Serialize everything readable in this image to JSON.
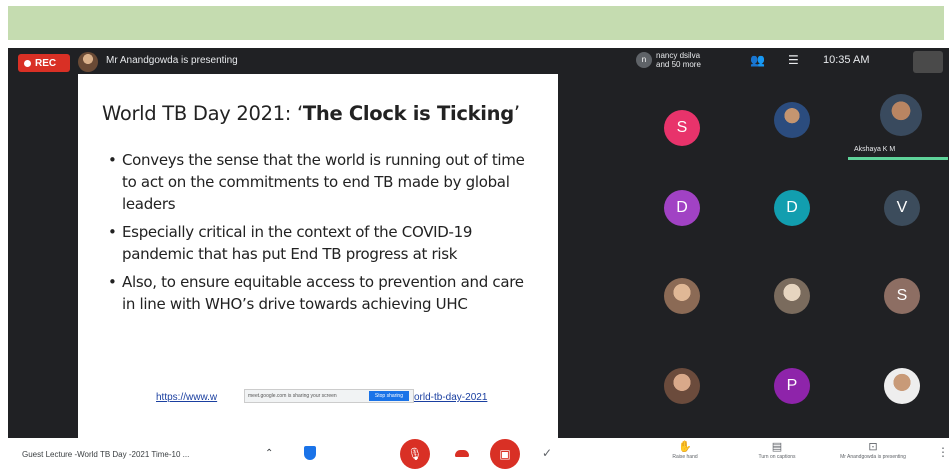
{
  "meeting": {
    "rec_label": "REC",
    "presenting_text": "Mr Anandgowda is presenting",
    "others_text_1": "nancy dsilva",
    "others_text_2": "and 50 more",
    "others_initial": "n",
    "time": "10:35 AM",
    "active_speaker_name": "Akshaya K M"
  },
  "slide": {
    "title_prefix": "World TB Day 2021: ‘",
    "title_bold": "The Clock is Ticking",
    "title_suffix": "’",
    "bullets": [
      "Conveys the sense that the world is running out of time to act on the commitments to end TB made by global leaders",
      "Especially critical in the context of the COVID-19 pandemic that has put End TB progress at risk",
      "Also, to ensure equitable access to prevention and care in line with WHO’s drive towards achieving UHC"
    ],
    "link_start": "https://www.w",
    "link_end": "orld-tb-day-2021",
    "share_notice": "meet.google.com is sharing your screen",
    "stop_label": "Stop sharing"
  },
  "participants": [
    {
      "initial": "S",
      "color": "#e8336b"
    },
    {
      "initial": "D",
      "color": "#a142c4"
    },
    {
      "initial": "D",
      "color": "#129eaf"
    },
    {
      "initial": "V",
      "color": "#3c4c5c"
    },
    {
      "initial": "S",
      "color": "#8d6e63"
    },
    {
      "initial": "P",
      "color": "#8e24aa"
    }
  ],
  "bottom": {
    "meeting_name": "Guest Lecture -World TB Day -2021 Time-10 ...",
    "raise_hand": "Raise hand",
    "captions": "Turn on captions",
    "presenting": "Mr Anandgowda is presenting"
  },
  "colors": {
    "top_bar": "#c5dcb0",
    "meet_bg": "#202124",
    "danger": "#d93025",
    "speaker": "#5fd39a"
  }
}
